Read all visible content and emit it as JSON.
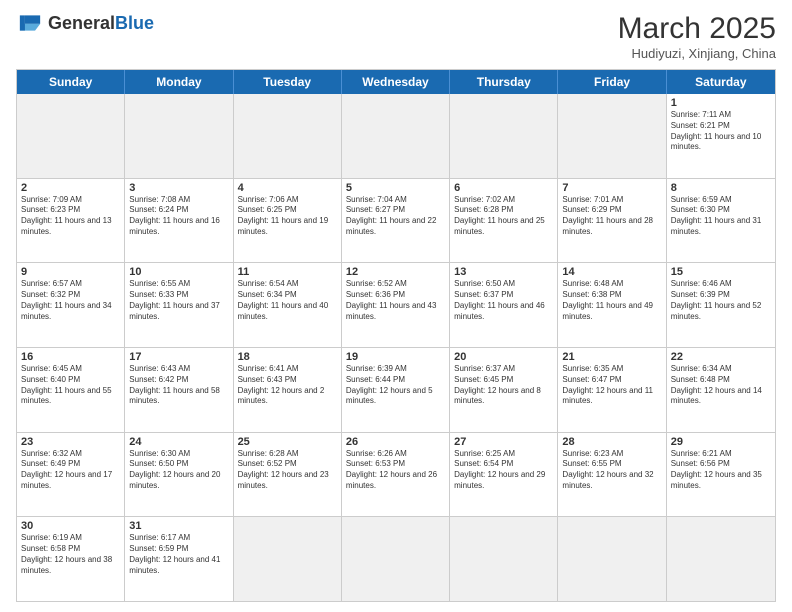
{
  "logo": {
    "text_general": "General",
    "text_blue": "Blue"
  },
  "header": {
    "month": "March 2025",
    "location": "Hudiyuzi, Xinjiang, China"
  },
  "days_of_week": [
    "Sunday",
    "Monday",
    "Tuesday",
    "Wednesday",
    "Thursday",
    "Friday",
    "Saturday"
  ],
  "weeks": [
    [
      {
        "day": "",
        "info": "",
        "empty": true
      },
      {
        "day": "",
        "info": "",
        "empty": true
      },
      {
        "day": "",
        "info": "",
        "empty": true
      },
      {
        "day": "",
        "info": "",
        "empty": true
      },
      {
        "day": "",
        "info": "",
        "empty": true
      },
      {
        "day": "",
        "info": "",
        "empty": true
      },
      {
        "day": "1",
        "info": "Sunrise: 7:11 AM\nSunset: 6:21 PM\nDaylight: 11 hours and 10 minutes.",
        "empty": false
      }
    ],
    [
      {
        "day": "2",
        "info": "Sunrise: 7:09 AM\nSunset: 6:23 PM\nDaylight: 11 hours and 13 minutes.",
        "empty": false
      },
      {
        "day": "3",
        "info": "Sunrise: 7:08 AM\nSunset: 6:24 PM\nDaylight: 11 hours and 16 minutes.",
        "empty": false
      },
      {
        "day": "4",
        "info": "Sunrise: 7:06 AM\nSunset: 6:25 PM\nDaylight: 11 hours and 19 minutes.",
        "empty": false
      },
      {
        "day": "5",
        "info": "Sunrise: 7:04 AM\nSunset: 6:27 PM\nDaylight: 11 hours and 22 minutes.",
        "empty": false
      },
      {
        "day": "6",
        "info": "Sunrise: 7:02 AM\nSunset: 6:28 PM\nDaylight: 11 hours and 25 minutes.",
        "empty": false
      },
      {
        "day": "7",
        "info": "Sunrise: 7:01 AM\nSunset: 6:29 PM\nDaylight: 11 hours and 28 minutes.",
        "empty": false
      },
      {
        "day": "8",
        "info": "Sunrise: 6:59 AM\nSunset: 6:30 PM\nDaylight: 11 hours and 31 minutes.",
        "empty": false
      }
    ],
    [
      {
        "day": "9",
        "info": "Sunrise: 6:57 AM\nSunset: 6:32 PM\nDaylight: 11 hours and 34 minutes.",
        "empty": false
      },
      {
        "day": "10",
        "info": "Sunrise: 6:55 AM\nSunset: 6:33 PM\nDaylight: 11 hours and 37 minutes.",
        "empty": false
      },
      {
        "day": "11",
        "info": "Sunrise: 6:54 AM\nSunset: 6:34 PM\nDaylight: 11 hours and 40 minutes.",
        "empty": false
      },
      {
        "day": "12",
        "info": "Sunrise: 6:52 AM\nSunset: 6:36 PM\nDaylight: 11 hours and 43 minutes.",
        "empty": false
      },
      {
        "day": "13",
        "info": "Sunrise: 6:50 AM\nSunset: 6:37 PM\nDaylight: 11 hours and 46 minutes.",
        "empty": false
      },
      {
        "day": "14",
        "info": "Sunrise: 6:48 AM\nSunset: 6:38 PM\nDaylight: 11 hours and 49 minutes.",
        "empty": false
      },
      {
        "day": "15",
        "info": "Sunrise: 6:46 AM\nSunset: 6:39 PM\nDaylight: 11 hours and 52 minutes.",
        "empty": false
      }
    ],
    [
      {
        "day": "16",
        "info": "Sunrise: 6:45 AM\nSunset: 6:40 PM\nDaylight: 11 hours and 55 minutes.",
        "empty": false
      },
      {
        "day": "17",
        "info": "Sunrise: 6:43 AM\nSunset: 6:42 PM\nDaylight: 11 hours and 58 minutes.",
        "empty": false
      },
      {
        "day": "18",
        "info": "Sunrise: 6:41 AM\nSunset: 6:43 PM\nDaylight: 12 hours and 2 minutes.",
        "empty": false
      },
      {
        "day": "19",
        "info": "Sunrise: 6:39 AM\nSunset: 6:44 PM\nDaylight: 12 hours and 5 minutes.",
        "empty": false
      },
      {
        "day": "20",
        "info": "Sunrise: 6:37 AM\nSunset: 6:45 PM\nDaylight: 12 hours and 8 minutes.",
        "empty": false
      },
      {
        "day": "21",
        "info": "Sunrise: 6:35 AM\nSunset: 6:47 PM\nDaylight: 12 hours and 11 minutes.",
        "empty": false
      },
      {
        "day": "22",
        "info": "Sunrise: 6:34 AM\nSunset: 6:48 PM\nDaylight: 12 hours and 14 minutes.",
        "empty": false
      }
    ],
    [
      {
        "day": "23",
        "info": "Sunrise: 6:32 AM\nSunset: 6:49 PM\nDaylight: 12 hours and 17 minutes.",
        "empty": false
      },
      {
        "day": "24",
        "info": "Sunrise: 6:30 AM\nSunset: 6:50 PM\nDaylight: 12 hours and 20 minutes.",
        "empty": false
      },
      {
        "day": "25",
        "info": "Sunrise: 6:28 AM\nSunset: 6:52 PM\nDaylight: 12 hours and 23 minutes.",
        "empty": false
      },
      {
        "day": "26",
        "info": "Sunrise: 6:26 AM\nSunset: 6:53 PM\nDaylight: 12 hours and 26 minutes.",
        "empty": false
      },
      {
        "day": "27",
        "info": "Sunrise: 6:25 AM\nSunset: 6:54 PM\nDaylight: 12 hours and 29 minutes.",
        "empty": false
      },
      {
        "day": "28",
        "info": "Sunrise: 6:23 AM\nSunset: 6:55 PM\nDaylight: 12 hours and 32 minutes.",
        "empty": false
      },
      {
        "day": "29",
        "info": "Sunrise: 6:21 AM\nSunset: 6:56 PM\nDaylight: 12 hours and 35 minutes.",
        "empty": false
      }
    ],
    [
      {
        "day": "30",
        "info": "Sunrise: 6:19 AM\nSunset: 6:58 PM\nDaylight: 12 hours and 38 minutes.",
        "empty": false
      },
      {
        "day": "31",
        "info": "Sunrise: 6:17 AM\nSunset: 6:59 PM\nDaylight: 12 hours and 41 minutes.",
        "empty": false
      },
      {
        "day": "",
        "info": "",
        "empty": true
      },
      {
        "day": "",
        "info": "",
        "empty": true
      },
      {
        "day": "",
        "info": "",
        "empty": true
      },
      {
        "day": "",
        "info": "",
        "empty": true
      },
      {
        "day": "",
        "info": "",
        "empty": true
      }
    ]
  ]
}
